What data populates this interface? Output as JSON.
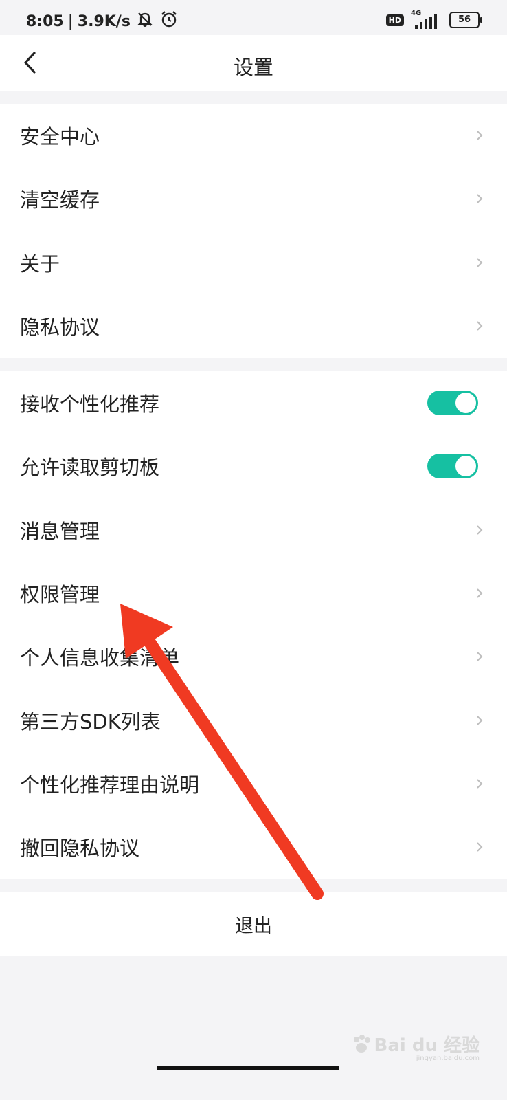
{
  "status_bar": {
    "time": "8:05",
    "separator": "|",
    "speed": "3.9K/s",
    "hd": "HD",
    "network": "4G",
    "battery": "56"
  },
  "header": {
    "title": "设置",
    "back_icon": "chevron-left-icon"
  },
  "group1": {
    "items": [
      {
        "label": "安全中心"
      },
      {
        "label": "清空缓存"
      },
      {
        "label": "关于"
      },
      {
        "label": "隐私协议"
      }
    ]
  },
  "group2": {
    "items": [
      {
        "label": "接收个性化推荐",
        "toggle": true
      },
      {
        "label": "允许读取剪切板",
        "toggle": true
      },
      {
        "label": "消息管理"
      },
      {
        "label": "权限管理"
      },
      {
        "label": "个人信息收集清单"
      },
      {
        "label": "第三方SDK列表"
      },
      {
        "label": "个性化推荐理由说明"
      },
      {
        "label": "撤回隐私协议"
      }
    ]
  },
  "logout_label": "退出",
  "watermark": {
    "brand": "Bai du 经验",
    "url": "jingyan.baidu.com"
  },
  "colors": {
    "toggle_on": "#16c0a2",
    "annotation_arrow": "#f03a22",
    "background": "#f4f4f6"
  }
}
